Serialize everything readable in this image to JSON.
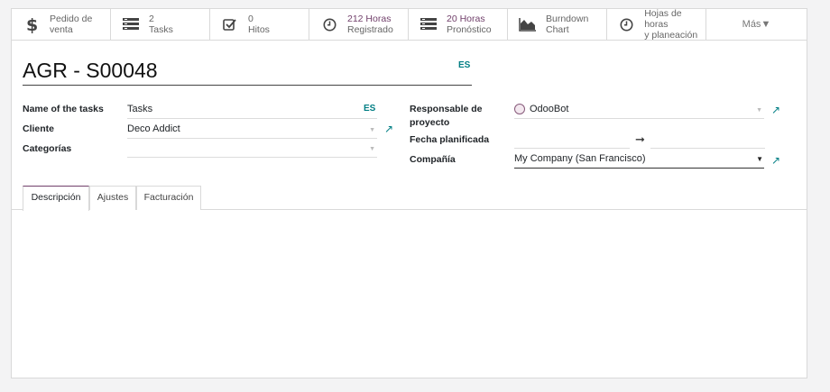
{
  "smart_buttons": [
    {
      "icon": "dollar-icon",
      "line1": "Pedido de",
      "line2": "venta",
      "highlight": false
    },
    {
      "icon": "tasks-icon",
      "line1": "2",
      "line2": "Tasks",
      "highlight": false
    },
    {
      "icon": "checkbox-icon",
      "line1": "0",
      "line2": "Hitos",
      "highlight": false
    },
    {
      "icon": "clock-icon",
      "line1": "212 Horas",
      "line2": "Registrado",
      "highlight": true
    },
    {
      "icon": "tasks-icon",
      "line1": "20 Horas",
      "line2": "Pronóstico",
      "highlight": true
    },
    {
      "icon": "area-chart-icon",
      "line1": "Burndown",
      "line2": "Chart",
      "highlight": false
    },
    {
      "icon": "clock-icon",
      "line1": "Hojas de horas",
      "line2": "y planeación",
      "highlight": false
    }
  ],
  "more_label": "Más",
  "title": "AGR - S00048",
  "title_lang": "ES",
  "fields": {
    "tasks_name_label": "Name of the tasks",
    "tasks_name_value": "Tasks",
    "tasks_name_lang": "ES",
    "client_label": "Cliente",
    "client_value": "Deco Addict",
    "categories_label": "Categorías",
    "categories_value": "",
    "manager_label": "Responsable de proyecto",
    "manager_value": "OdooBot",
    "planned_date_label": "Fecha planificada",
    "planned_start": "",
    "planned_end": "",
    "company_label": "Compañía",
    "company_value": "My Company (San Francisco)"
  },
  "tabs": [
    "Descripción",
    "Ajustes",
    "Facturación"
  ],
  "colors": {
    "brand": "#71406b",
    "accent": "#017e84"
  }
}
